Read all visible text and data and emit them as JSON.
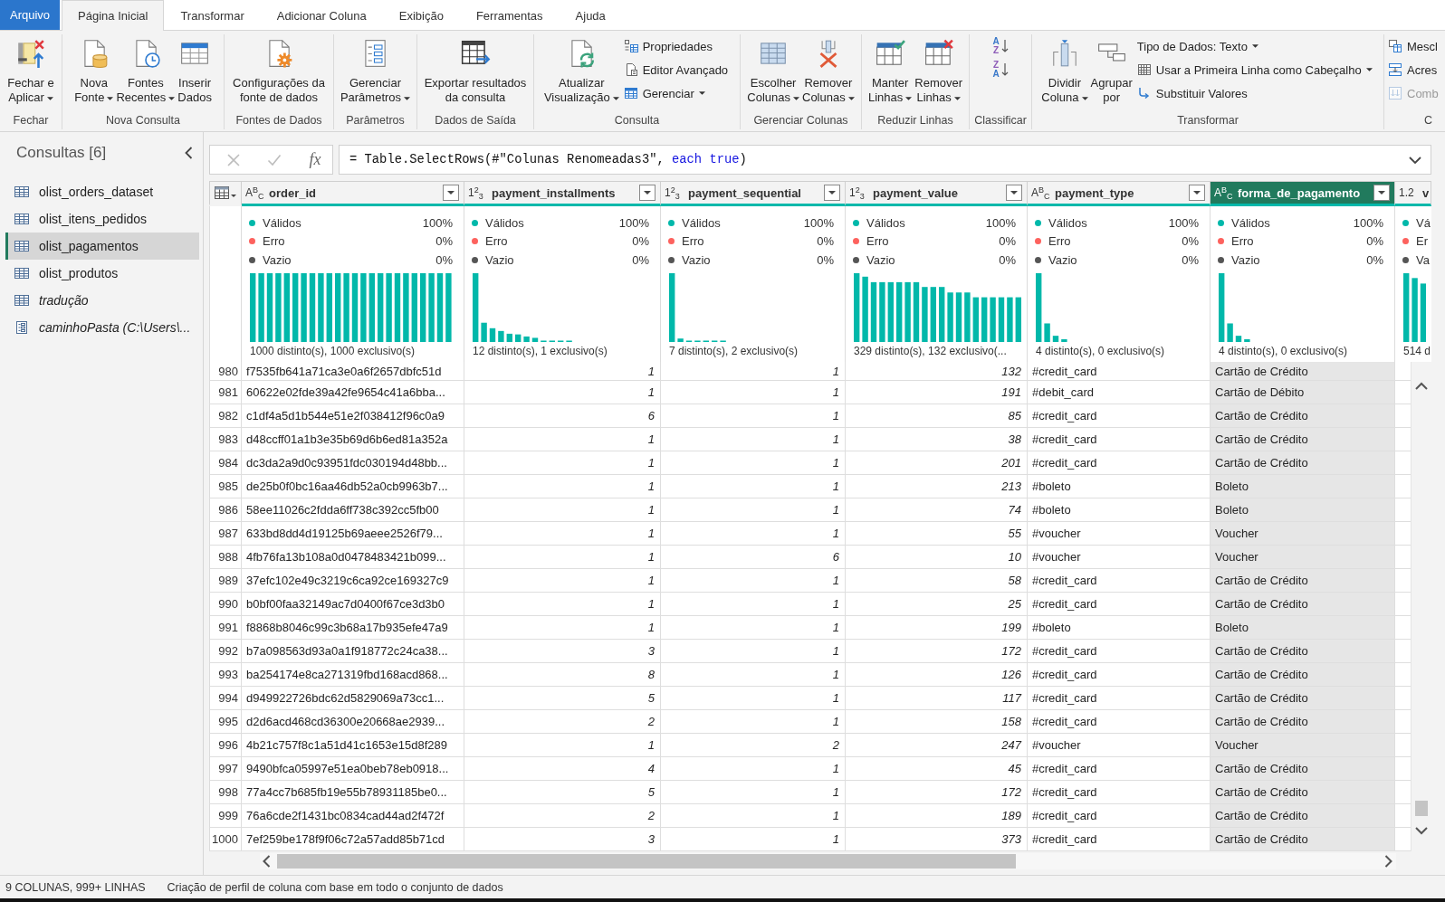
{
  "ribbon": {
    "tabs": [
      {
        "label": "Arquivo",
        "kind": "file",
        "selected": false
      },
      {
        "label": "Página Inicial",
        "kind": "tab",
        "selected": true
      },
      {
        "label": "Transformar",
        "kind": "tab",
        "selected": false
      },
      {
        "label": "Adicionar Coluna",
        "kind": "tab",
        "selected": false
      },
      {
        "label": "Exibição",
        "kind": "tab",
        "selected": false
      },
      {
        "label": "Ferramentas",
        "kind": "tab",
        "selected": false
      },
      {
        "label": "Ajuda",
        "kind": "tab",
        "selected": false
      }
    ],
    "groups": [
      {
        "label": "Fechar",
        "items": [
          {
            "kind": "large",
            "lines": [
              "Fechar e",
              "Aplicar"
            ],
            "dropdown": true
          }
        ]
      },
      {
        "label": "Nova Consulta",
        "items": [
          {
            "kind": "large",
            "lines": [
              "Nova",
              "Fonte"
            ],
            "dropdown": true
          },
          {
            "kind": "large",
            "lines": [
              "Fontes",
              "Recentes"
            ],
            "dropdown": true
          },
          {
            "kind": "large",
            "lines": [
              "Inserir",
              "Dados"
            ],
            "dropdown": false
          }
        ]
      },
      {
        "label": "Fontes de Dados",
        "items": [
          {
            "kind": "large",
            "lines": [
              "Configurações da",
              "fonte de dados"
            ],
            "dropdown": false
          }
        ]
      },
      {
        "label": "Parâmetros",
        "items": [
          {
            "kind": "large",
            "lines": [
              "Gerenciar",
              "Parâmetros"
            ],
            "dropdown": true
          }
        ]
      },
      {
        "label": "Dados de Saída",
        "items": [
          {
            "kind": "large",
            "lines": [
              "Exportar resultados",
              "da consulta"
            ],
            "dropdown": false
          }
        ]
      },
      {
        "label": "Consulta",
        "items": [
          {
            "kind": "large",
            "lines": [
              "Atualizar",
              "Visualização"
            ],
            "dropdown": true
          },
          {
            "kind": "stack",
            "entries": [
              {
                "kind": "small",
                "label": "Propriedades",
                "dropdown": false,
                "disabled": false
              },
              {
                "kind": "small",
                "label": "Editor Avançado",
                "dropdown": false,
                "disabled": false
              },
              {
                "kind": "small",
                "label": "Gerenciar",
                "dropdown": true,
                "disabled": false
              }
            ]
          }
        ]
      },
      {
        "label": "Gerenciar Colunas",
        "items": [
          {
            "kind": "large",
            "lines": [
              "Escolher",
              "Colunas"
            ],
            "dropdown": true
          },
          {
            "kind": "large",
            "lines": [
              "Remover",
              "Colunas"
            ],
            "dropdown": true
          }
        ]
      },
      {
        "label": "Reduzir Linhas",
        "items": [
          {
            "kind": "large",
            "lines": [
              "Manter",
              "Linhas"
            ],
            "dropdown": true
          },
          {
            "kind": "large",
            "lines": [
              "Remover",
              "Linhas"
            ],
            "dropdown": true
          }
        ]
      },
      {
        "label": "Classificar",
        "items": [
          {
            "kind": "stack",
            "entries": [
              {
                "kind": "sort",
                "letters": [
                  {
                    "char": "A",
                    "color": "#3a78c9"
                  },
                  {
                    "char": "Z",
                    "color": "#8d5cb8"
                  }
                ],
                "disabled": false
              },
              {
                "kind": "sort",
                "letters": [
                  {
                    "char": "Z",
                    "color": "#8d5cb8"
                  },
                  {
                    "char": "A",
                    "color": "#3a78c9"
                  }
                ],
                "disabled": false
              }
            ]
          }
        ]
      },
      {
        "label": "Transformar",
        "items": [
          {
            "kind": "large",
            "lines": [
              "Dividir",
              "Coluna"
            ],
            "dropdown": true
          },
          {
            "kind": "large",
            "lines": [
              "Agrupar",
              "por"
            ],
            "dropdown": false
          },
          {
            "kind": "stack",
            "entries": [
              {
                "kind": "small",
                "label": "Tipo de Dados: Texto",
                "dropdown": true,
                "disabled": false
              },
              {
                "kind": "small",
                "label": "Usar a Primeira Linha como Cabeçalho",
                "dropdown": true,
                "disabled": false
              },
              {
                "kind": "small",
                "label": "Substituir Valores",
                "dropdown": false,
                "disabled": false
              }
            ]
          }
        ]
      },
      {
        "label": "C",
        "items": [
          {
            "kind": "stack",
            "entries": [
              {
                "kind": "small",
                "label": "Mescl",
                "dropdown": false,
                "disabled": false
              },
              {
                "kind": "small",
                "label": "Acres",
                "dropdown": false,
                "disabled": false
              },
              {
                "kind": "small",
                "label": "Comb",
                "dropdown": false,
                "disabled": true
              }
            ]
          }
        ]
      }
    ]
  },
  "queries": {
    "title": "Consultas [6]",
    "items": [
      {
        "name": "olist_orders_dataset",
        "kind": "table",
        "selected": false,
        "load_enabled": true
      },
      {
        "name": "olist_itens_pedidos",
        "kind": "table",
        "selected": false,
        "load_enabled": true
      },
      {
        "name": "olist_pagamentos",
        "kind": "table",
        "selected": true,
        "load_enabled": true
      },
      {
        "name": "olist_produtos",
        "kind": "table",
        "selected": false,
        "load_enabled": true
      },
      {
        "name": "tradução",
        "kind": "table",
        "selected": false,
        "load_enabled": false
      },
      {
        "name": "caminhoPasta (C:\\Users\\...",
        "kind": "parameter",
        "selected": false,
        "load_enabled": false
      }
    ]
  },
  "formula_bar": {
    "function_label": "fx",
    "tokens": [
      {
        "text": "= Table.SelectRows(#\"Colunas Renomeadas3\", ",
        "kind": "plain"
      },
      {
        "text": "each true",
        "kind": "keyword"
      },
      {
        "text": ")",
        "kind": "plain"
      }
    ]
  },
  "grid": {
    "columns": [
      {
        "type_glyph": "A$^{B}$$_{C}$",
        "name": "order_id",
        "kind": "text",
        "selected": false,
        "filter_button": true,
        "profile": {
          "stats": [
            {
              "label": "Válidos",
              "value": "100%",
              "color": "#01b8aa"
            },
            {
              "label": "Erro",
              "value": "0%",
              "color": "#fd625e"
            },
            {
              "label": "Vazio",
              "value": "0%",
              "color": "#555555"
            }
          ],
          "histogram": {
            "kind": "uniform"
          },
          "summary": "1000 distinto(s), 1000 exclusivo(s)"
        }
      },
      {
        "type_glyph": "1$^{2}$$_{3}$",
        "name": "payment_installments",
        "kind": "number",
        "selected": false,
        "filter_button": true,
        "profile": {
          "stats": [
            {
              "label": "Válidos",
              "value": "100%",
              "color": "#01b8aa"
            },
            {
              "label": "Erro",
              "value": "0%",
              "color": "#fd625e"
            },
            {
              "label": "Vazio",
              "value": "0%",
              "color": "#555555"
            }
          ],
          "histogram": {
            "kind": "long_tail"
          },
          "summary": "12 distinto(s), 1 exclusivo(s)"
        }
      },
      {
        "type_glyph": "1$^{2}$$_{3}$",
        "name": "payment_sequential",
        "kind": "number",
        "selected": false,
        "filter_button": true,
        "profile": {
          "stats": [
            {
              "label": "Válidos",
              "value": "100%",
              "color": "#01b8aa"
            },
            {
              "label": "Erro",
              "value": "0%",
              "color": "#fd625e"
            },
            {
              "label": "Vazio",
              "value": "0%",
              "color": "#555555"
            }
          ],
          "histogram": {
            "kind": "single_peak"
          },
          "summary": "7 distinto(s), 2 exclusivo(s)"
        }
      },
      {
        "type_glyph": "1$^{2}$$_{3}$",
        "name": "payment_value",
        "kind": "number",
        "selected": false,
        "filter_button": true,
        "profile": {
          "stats": [
            {
              "label": "Válidos",
              "value": "100%",
              "color": "#01b8aa"
            },
            {
              "label": "Erro",
              "value": "0%",
              "color": "#fd625e"
            },
            {
              "label": "Vazio",
              "value": "0%",
              "color": "#555555"
            }
          ],
          "histogram": {
            "kind": "stepped"
          },
          "summary": "329 distinto(s), 132 exclusivo(..."
        }
      },
      {
        "type_glyph": "A$^{B}$$_{C}$",
        "name": "payment_type",
        "kind": "text",
        "selected": false,
        "filter_button": true,
        "profile": {
          "stats": [
            {
              "label": "Válidos",
              "value": "100%",
              "color": "#01b8aa"
            },
            {
              "label": "Erro",
              "value": "0%",
              "color": "#fd625e"
            },
            {
              "label": "Vazio",
              "value": "0%",
              "color": "#555555"
            }
          ],
          "histogram": {
            "kind": "few_values"
          },
          "summary": "4 distinto(s), 0 exclusivo(s)"
        }
      },
      {
        "type_glyph": "A$^{B}$$_{C}$",
        "name": "forma_de_pagamento",
        "kind": "text",
        "selected": true,
        "filter_button": true,
        "profile": {
          "stats": [
            {
              "label": "Válidos",
              "value": "100%",
              "color": "#01b8aa"
            },
            {
              "label": "Erro",
              "value": "0%",
              "color": "#fd625e"
            },
            {
              "label": "Vazio",
              "value": "0%",
              "color": "#555555"
            }
          ],
          "histogram": {
            "kind": "few_values"
          },
          "summary": "4 distinto(s), 0 exclusivo(s)"
        }
      },
      {
        "type_glyph": "1.2",
        "name": "v",
        "selected": false,
        "filter_button": false,
        "profile": {
          "stats": [
            {
              "label": "Vá",
              "color": "#01b8aa"
            },
            {
              "label": "Er",
              "color": "#fd625e"
            },
            {
              "label": "Va",
              "color": "#555555"
            }
          ],
          "histogram": {
            "kind": "descending"
          },
          "summary": "514 d"
        }
      }
    ],
    "rows": [
      {
        "index": "980",
        "cells": [
          "f7535fb641a71ca3e0a6f2657dbfc51d",
          "1",
          "1",
          "132",
          "#credit_card",
          "Cartão de Crédito"
        ]
      },
      {
        "index": "981",
        "cells": [
          "60622e02fde39a42fe9654c41a6bba...",
          "1",
          "1",
          "191",
          "#debit_card",
          "Cartão de Débito"
        ]
      },
      {
        "index": "982",
        "cells": [
          "c1df4a5d1b544e51e2f038412f96c0a9",
          "6",
          "1",
          "85",
          "#credit_card",
          "Cartão de Crédito"
        ]
      },
      {
        "index": "983",
        "cells": [
          "d48ccff01a1b3e35b69d6b6ed81a352a",
          "1",
          "1",
          "38",
          "#credit_card",
          "Cartão de Crédito"
        ]
      },
      {
        "index": "984",
        "cells": [
          "dc3da2a9d0c93951fdc030194d48bb...",
          "1",
          "1",
          "201",
          "#credit_card",
          "Cartão de Crédito"
        ]
      },
      {
        "index": "985",
        "cells": [
          "de25b0f0bc16aa46db52a0cb9963b7...",
          "1",
          "1",
          "213",
          "#boleto",
          "Boleto"
        ]
      },
      {
        "index": "986",
        "cells": [
          "58ee11026c2fdda6ff738c392cc5fb00",
          "1",
          "1",
          "74",
          "#boleto",
          "Boleto"
        ]
      },
      {
        "index": "987",
        "cells": [
          "633bd8dd4d19125b69aeee2526f79...",
          "1",
          "1",
          "55",
          "#voucher",
          "Voucher"
        ]
      },
      {
        "index": "988",
        "cells": [
          "4fb76fa13b108a0d0478483421b099...",
          "1",
          "6",
          "10",
          "#voucher",
          "Voucher"
        ]
      },
      {
        "index": "989",
        "cells": [
          "37efc102e49c3219c6ca92ce169327c9",
          "1",
          "1",
          "58",
          "#credit_card",
          "Cartão de Crédito"
        ]
      },
      {
        "index": "990",
        "cells": [
          "b0bf00faa32149ac7d0400f67ce3d3b0",
          "1",
          "1",
          "25",
          "#credit_card",
          "Cartão de Crédito"
        ]
      },
      {
        "index": "991",
        "cells": [
          "f8868b8046c99c3b68a17b935efe47a9",
          "1",
          "1",
          "199",
          "#boleto",
          "Boleto"
        ]
      },
      {
        "index": "992",
        "cells": [
          "b7a098563d93a0a1f918772c24ca38...",
          "3",
          "1",
          "172",
          "#credit_card",
          "Cartão de Crédito"
        ]
      },
      {
        "index": "993",
        "cells": [
          "ba254174e8ca271319fbd168acd868...",
          "8",
          "1",
          "126",
          "#credit_card",
          "Cartão de Crédito"
        ]
      },
      {
        "index": "994",
        "cells": [
          "d949922726bdc62d5829069a73cc1...",
          "5",
          "1",
          "117",
          "#credit_card",
          "Cartão de Crédito"
        ]
      },
      {
        "index": "995",
        "cells": [
          "d2d6acd468cd36300e20668ae2939...",
          "2",
          "1",
          "158",
          "#credit_card",
          "Cartão de Crédito"
        ]
      },
      {
        "index": "996",
        "cells": [
          "4b21c757f8c1a51d41c1653e15d8f289",
          "1",
          "2",
          "247",
          "#voucher",
          "Voucher"
        ]
      },
      {
        "index": "997",
        "cells": [
          "9490bfca05997e51ea0beb78eb0918...",
          "4",
          "1",
          "45",
          "#credit_card",
          "Cartão de Crédito"
        ]
      },
      {
        "index": "998",
        "cells": [
          "77a4cc7b685fb19e55b78931185be0...",
          "5",
          "1",
          "172",
          "#credit_card",
          "Cartão de Crédito"
        ]
      },
      {
        "index": "999",
        "cells": [
          "76a6cde2f1431bc0834cad44ad2f472f",
          "2",
          "1",
          "189",
          "#credit_card",
          "Cartão de Crédito"
        ]
      },
      {
        "index": "1000",
        "cells": [
          "7ef259be178f9f06c72a57add85b71cd",
          "3",
          "1",
          "373",
          "#credit_card",
          "Cartão de Crédito"
        ]
      }
    ]
  },
  "status_bar": {
    "summary": "9 COLUNAS, 999+ LINHAS",
    "profiling": "Criação de perfil de coluna com base em todo o conjunto de dados"
  }
}
